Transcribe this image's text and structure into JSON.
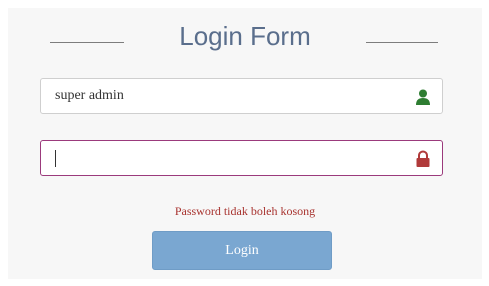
{
  "form": {
    "title": "Login Form",
    "username": {
      "value": "super admin",
      "icon": "user-icon",
      "icon_color": "#2e7d32"
    },
    "password": {
      "value": "",
      "icon": "lock-icon",
      "icon_color": "#b03a3a"
    },
    "error_message": "Password tidak boleh kosong",
    "login_label": "Login"
  },
  "colors": {
    "title": "#5a6e8c",
    "button": "#7aa7d1",
    "error": "#a8332f",
    "focus_border": "#9b3a7c"
  }
}
